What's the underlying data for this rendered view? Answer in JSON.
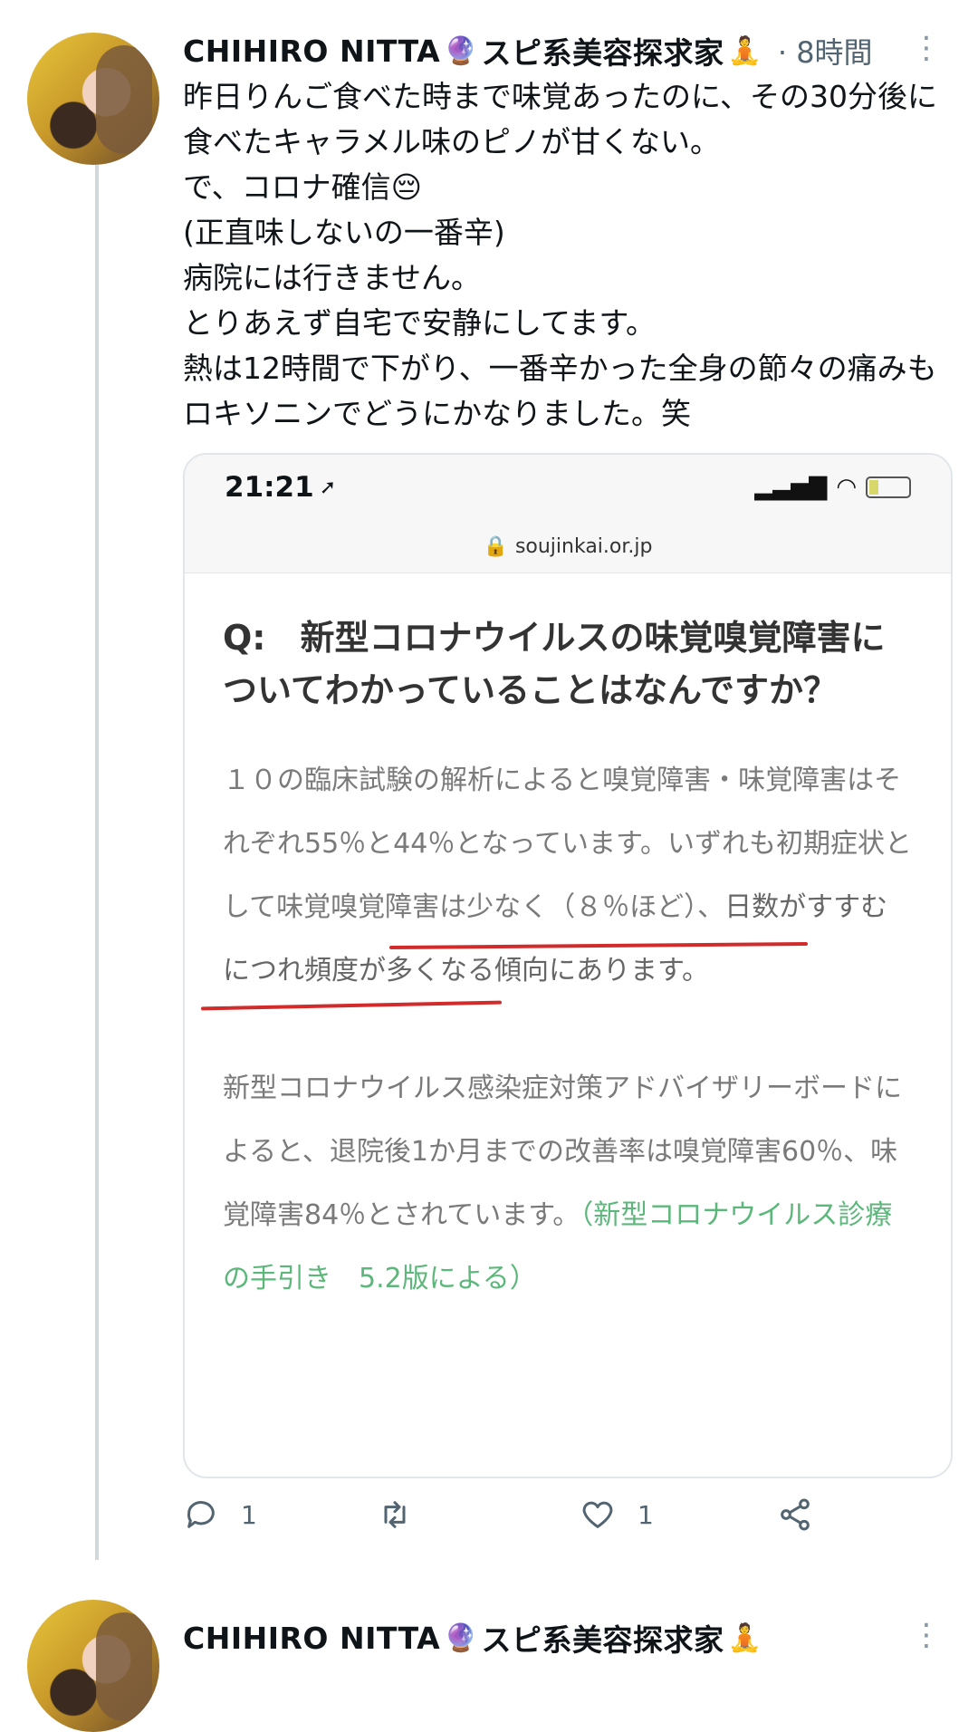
{
  "tweet1": {
    "display_name": "CHIHIRO NITTA",
    "name_emoji_1": "🔮",
    "name_suffix": "スピ系美容探求家",
    "name_emoji_2": "🧘",
    "time": "· 8時間",
    "text": "昨日りんご食べた時まで味覚あったのに、その30分後に食べたキャラメル味のピノが甘くない。\nで、コロナ確信😔\n(正直味しないの一番辛)\n病院には行きません。\nとりあえず自宅で安静にしてます。\n熱は12時間で下がり、一番辛かった全身の節々の痛みもロキソニンでどうにかなりました。笑",
    "card": {
      "status_time": "21:21",
      "url": "soujinkai.or.jp",
      "question": "Q:　新型コロナウイルスの味覚嗅覚障害についてわかっていることはなんですか？",
      "para1_a": "１０の臨床試験の解析によると嗅覚障害・味覚障害はそれぞれ55％と44％となっています。いずれも初期症状として味覚嗅覚障害は少なく（８％ほど）、",
      "para1_b": "日数がすすむにつれ頻度が多くなる傾向にあります。",
      "para2": "新型コロナウイルス感染症対策アドバイザリーボードによると、退院後1か月までの改善率は嗅覚障害60％、味覚障害84％とされています。",
      "para2_source": "（新型コロナウイルス診療の手引き　5.2版による）"
    },
    "actions": {
      "reply_count": "1",
      "retweet_count": "",
      "like_count": "1"
    }
  },
  "tweet2": {
    "display_name": "CHIHIRO NITTA",
    "name_emoji_1": "🔮",
    "name_suffix": "スピ系美容探求家",
    "name_emoji_2": "🧘"
  }
}
